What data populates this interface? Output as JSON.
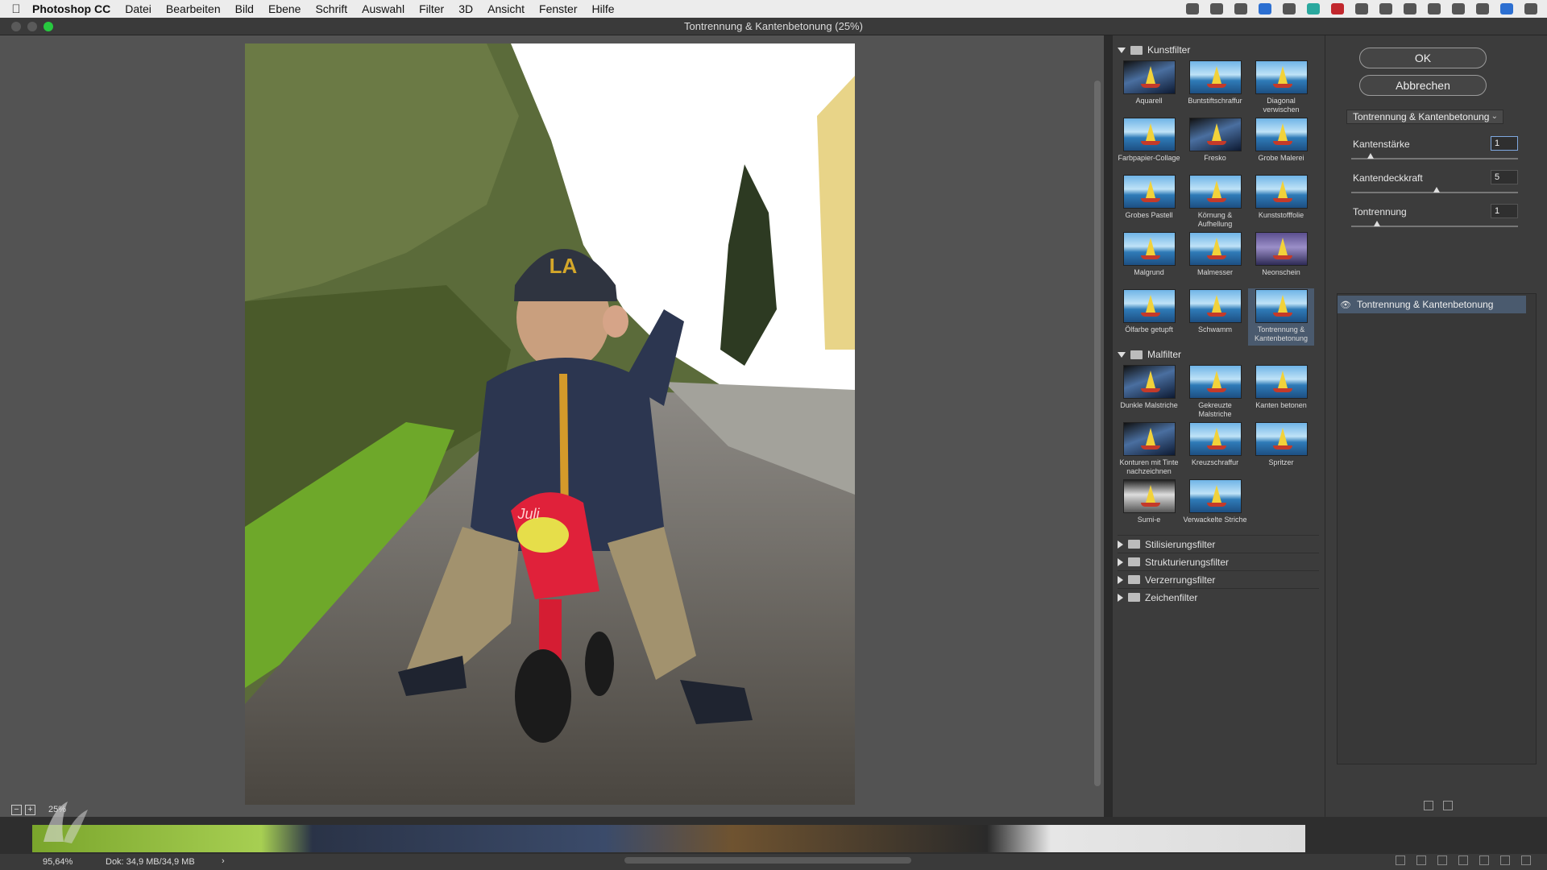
{
  "menubar": {
    "app_name": "Photoshop CC",
    "items": [
      "Datei",
      "Bearbeiten",
      "Bild",
      "Ebene",
      "Schrift",
      "Auswahl",
      "Filter",
      "3D",
      "Ansicht",
      "Fenster",
      "Hilfe"
    ]
  },
  "window": {
    "title": "Tontrennung & Kantenbetonung (25%)"
  },
  "preview": {
    "zoom_level": "25%"
  },
  "gallery": {
    "kunstfilter": {
      "label": "Kunstfilter",
      "items": [
        {
          "label": "Aquarell",
          "icon": "dark"
        },
        {
          "label": "Buntstiftschraffur",
          "icon": "normal"
        },
        {
          "label": "Diagonal verwischen",
          "icon": "normal"
        },
        {
          "label": "Farbpapier-Collage",
          "icon": "normal"
        },
        {
          "label": "Fresko",
          "icon": "dark"
        },
        {
          "label": "Grobe Malerei",
          "icon": "normal"
        },
        {
          "label": "Grobes Pastell",
          "icon": "normal"
        },
        {
          "label": "Körnung & Aufhellung",
          "icon": "normal"
        },
        {
          "label": "Kunststofffolie",
          "icon": "normal"
        },
        {
          "label": "Malgrund",
          "icon": "normal"
        },
        {
          "label": "Malmesser",
          "icon": "normal"
        },
        {
          "label": "Neonschein",
          "icon": "purple"
        },
        {
          "label": "Ölfarbe getupft",
          "icon": "normal"
        },
        {
          "label": "Schwamm",
          "icon": "normal"
        },
        {
          "label": "Tontrennung & Kantenbetonung",
          "icon": "normal"
        }
      ]
    },
    "malfilter": {
      "label": "Malfilter",
      "items": [
        {
          "label": "Dunkle Malstriche",
          "icon": "dark"
        },
        {
          "label": "Gekreuzte Malstriche",
          "icon": "normal"
        },
        {
          "label": "Kanten betonen",
          "icon": "normal"
        },
        {
          "label": "Konturen mit Tinte nachzeichnen",
          "icon": "dark"
        },
        {
          "label": "Kreuzschraffur",
          "icon": "normal"
        },
        {
          "label": "Spritzer",
          "icon": "normal"
        },
        {
          "label": "Sumi-e",
          "icon": "bw"
        },
        {
          "label": "Verwackelte Striche",
          "icon": "normal"
        }
      ]
    },
    "collapsed_groups": [
      "Stilisierungsfilter",
      "Strukturierungsfilter",
      "Verzerrungsfilter",
      "Zeichenfilter"
    ]
  },
  "panel": {
    "ok_label": "OK",
    "cancel_label": "Abbrechen",
    "selected_filter": "Tontrennung & Kantenbetonung",
    "params": [
      {
        "label": "Kantenstärke",
        "value": "1",
        "level": 0.1
      },
      {
        "label": "Kantendeckkraft",
        "value": "5",
        "level": 0.5
      },
      {
        "label": "Tontrennung",
        "value": "1",
        "level": 0.14
      }
    ],
    "effect_layer": "Tontrennung & Kantenbetonung"
  },
  "status": {
    "zoom": "95,64%",
    "doc": "Dok: 34,9 MB/34,9 MB",
    "arrow": "›"
  }
}
